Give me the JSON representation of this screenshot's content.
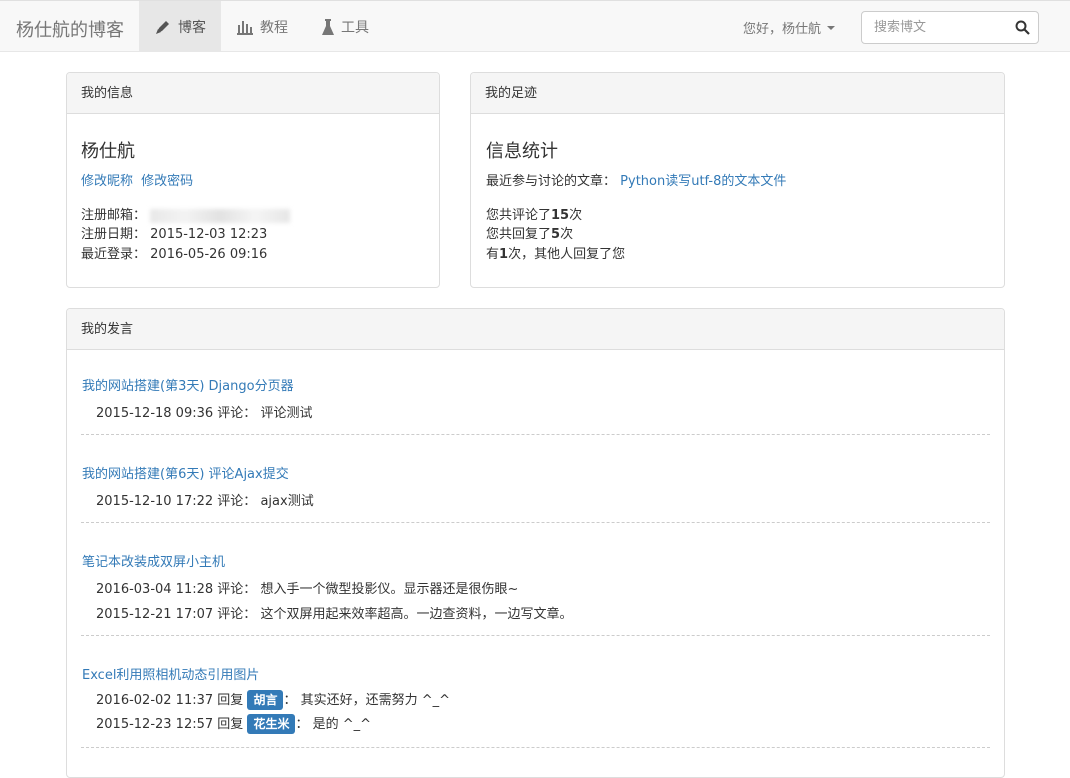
{
  "navbar": {
    "brand": "杨仕航的博客",
    "items": [
      {
        "label": "博客",
        "icon": "pen-icon",
        "active": true
      },
      {
        "label": "教程",
        "icon": "chart-icon",
        "active": false
      },
      {
        "label": "工具",
        "icon": "flask-icon",
        "active": false
      }
    ],
    "user_greeting": "您好，杨仕航",
    "search_placeholder": "搜索博文"
  },
  "info_panel": {
    "title": "我的信息",
    "name": "杨仕航",
    "edit_nickname": "修改昵称",
    "edit_password": "修改密码",
    "email_label": "注册邮箱：",
    "reg_date_label": "注册日期：",
    "reg_date": "2015-12-03 12:23",
    "last_login_label": "最近登录：",
    "last_login": "2016-05-26 09:16"
  },
  "footprint_panel": {
    "title": "我的足迹",
    "subtitle": "信息统计",
    "recent_label": "最近参与讨论的文章：",
    "recent_article": "Python读写utf-8的文本文件",
    "stat1_pre": "您共评论了",
    "stat1_num": "15",
    "stat1_post": "次",
    "stat2_pre": "您共回复了",
    "stat2_num": "5",
    "stat2_post": "次",
    "stat3_pre": "有",
    "stat3_num": "1",
    "stat3_post": "次，其他人回复了您"
  },
  "posts_panel": {
    "title": "我的发言",
    "articles": [
      {
        "title": "我的网站搭建(第3天) Django分页器",
        "entries": [
          {
            "time": "2015-12-18 09:36",
            "action": "评论：",
            "reply_to": "",
            "text": "评论测试"
          }
        ]
      },
      {
        "title": "我的网站搭建(第6天) 评论Ajax提交",
        "entries": [
          {
            "time": "2015-12-10 17:22",
            "action": "评论：",
            "reply_to": "",
            "text": "ajax测试"
          }
        ]
      },
      {
        "title": "笔记本改装成双屏小主机",
        "entries": [
          {
            "time": "2016-03-04 11:28",
            "action": "评论：",
            "reply_to": "",
            "text": "想入手一个微型投影仪。显示器还是很伤眼~"
          },
          {
            "time": "2015-12-21 17:07",
            "action": "评论：",
            "reply_to": "",
            "text": "这个双屏用起来效率超高。一边查资料，一边写文章。"
          }
        ]
      },
      {
        "title": "Excel利用照相机动态引用图片",
        "entries": [
          {
            "time": "2016-02-02 11:37",
            "action": "回复",
            "reply_to": "胡言",
            "text": "其实还好，还需努力 ^_^"
          },
          {
            "time": "2015-12-23 12:57",
            "action": "回复",
            "reply_to": "花生米",
            "text": "是的 ^_^"
          }
        ]
      }
    ]
  }
}
